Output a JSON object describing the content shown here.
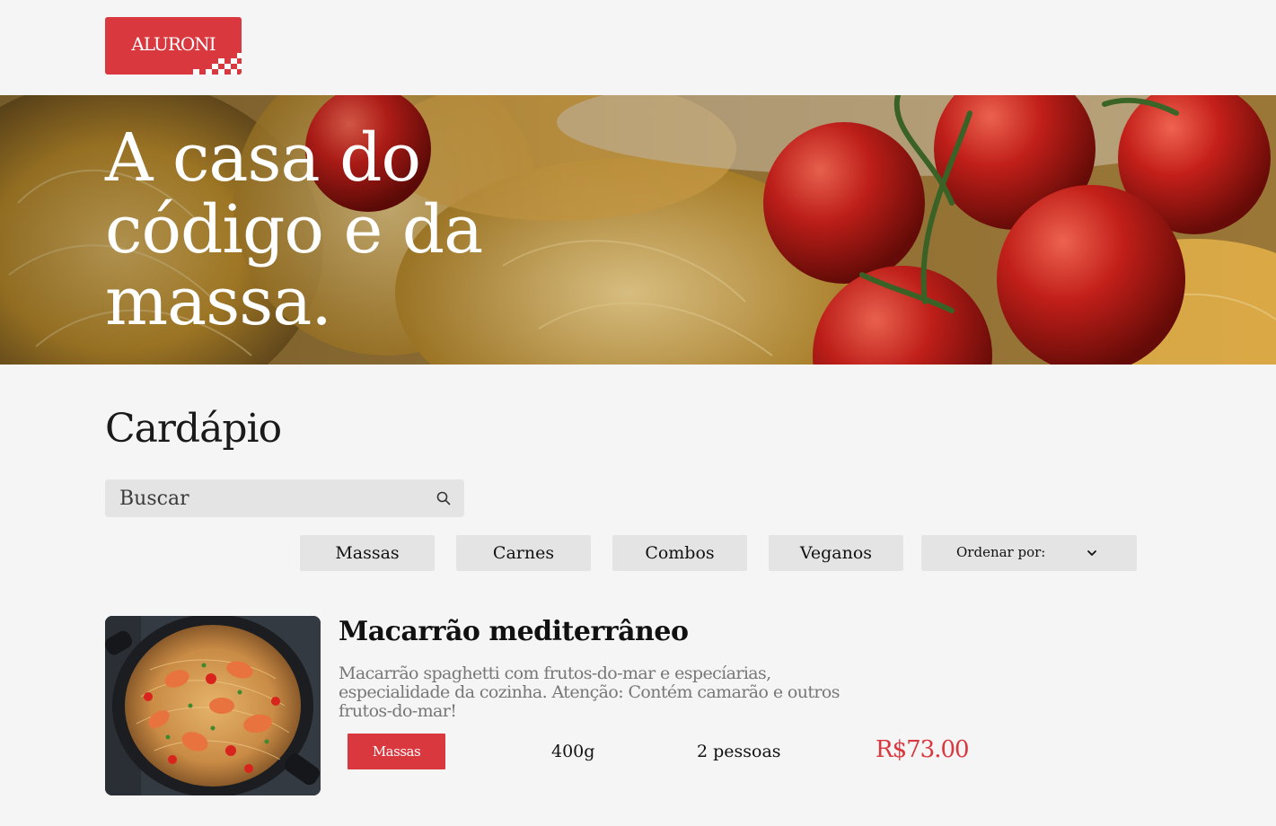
{
  "header": {
    "logo_text": "ALURONI",
    "colors": {
      "brand": "#d9383f",
      "background": "#f5f5f5"
    }
  },
  "hero": {
    "title": "A casa do código e da massa."
  },
  "menu": {
    "title": "Cardápio",
    "search": {
      "placeholder": "Buscar",
      "icon": "search-icon"
    },
    "filters": [
      {
        "label": "Massas"
      },
      {
        "label": "Carnes"
      },
      {
        "label": "Combos"
      },
      {
        "label": "Veganos"
      }
    ],
    "sort": {
      "label": "Ordenar por:",
      "icon": "chevron-down-icon"
    },
    "items": [
      {
        "name": "Macarrão mediterrâneo",
        "description": "Macarrão spaghetti com frutos-do-mar e especíarias, especialidade da cozinha. Atenção: Contém camarão e outros frutos-do-mar!",
        "category": "Massas",
        "size": "400g",
        "serving": "2 pessoas",
        "price": "R$73.00"
      }
    ]
  }
}
